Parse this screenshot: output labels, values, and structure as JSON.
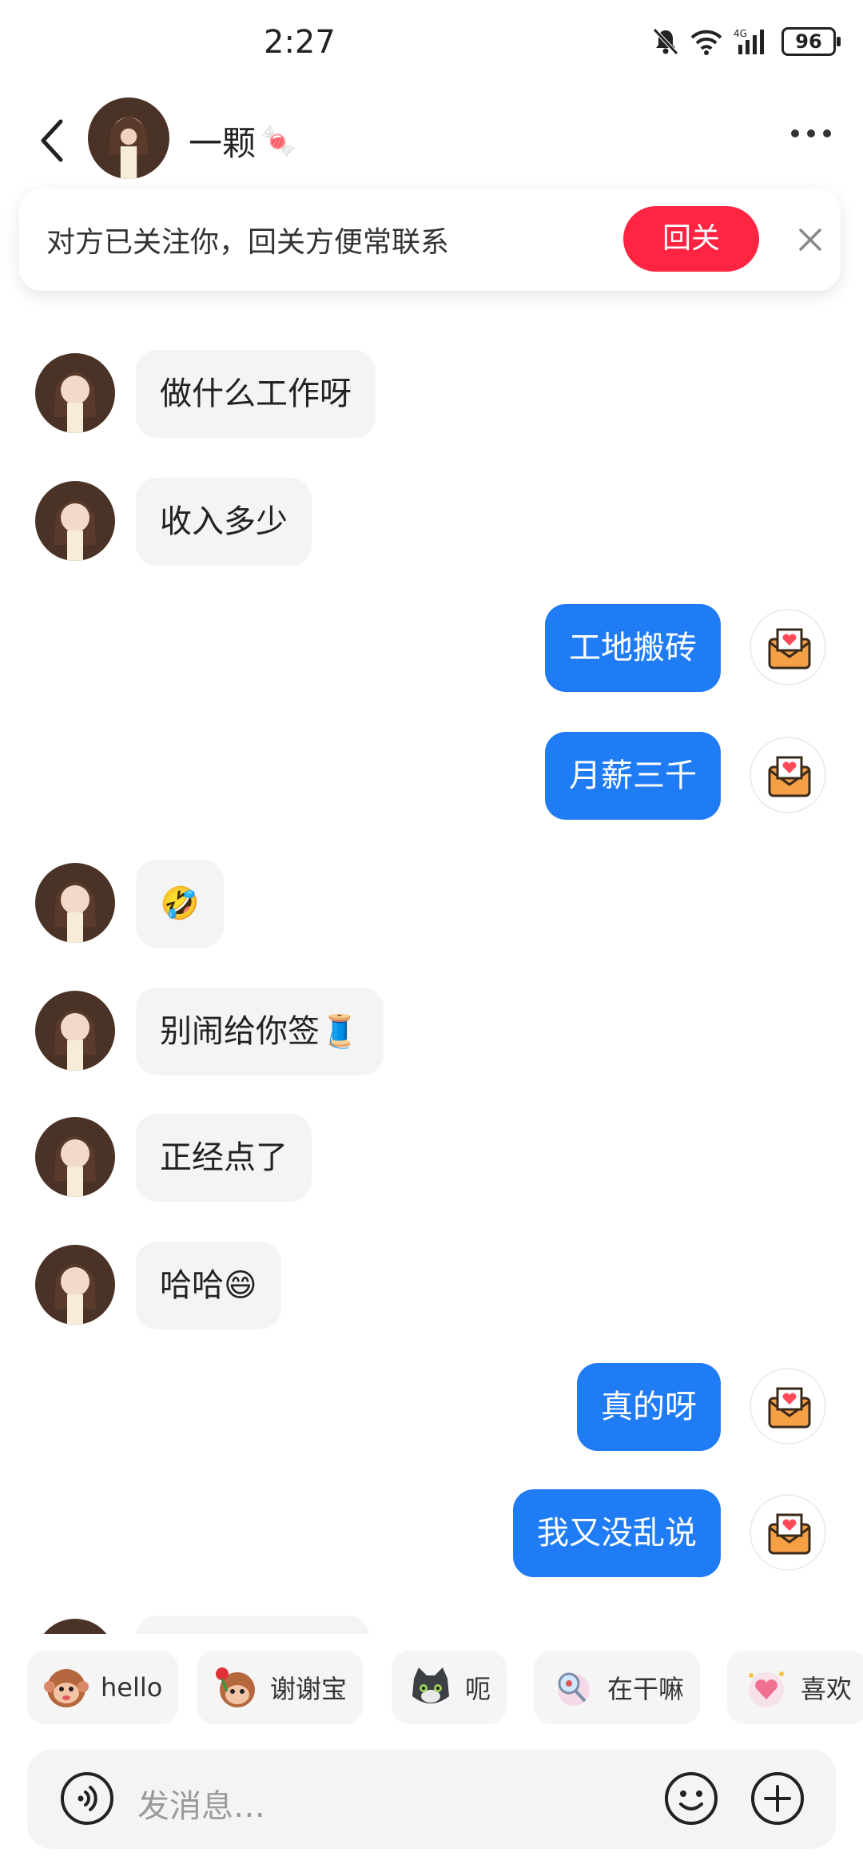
{
  "status_bar": {
    "time": "2:27",
    "battery": "96",
    "network": "4G"
  },
  "header": {
    "title": "一颗",
    "title_emoji": "🍬"
  },
  "banner": {
    "text": "对方已关注你，回关方便常联系",
    "follow_back_label": "回关"
  },
  "messages": [
    {
      "side": "in",
      "text": "做什么工作呀"
    },
    {
      "side": "in",
      "text": "收入多少"
    },
    {
      "side": "out",
      "text": "工地搬砖"
    },
    {
      "side": "out",
      "text": "月薪三千"
    },
    {
      "side": "in",
      "text": "🤣"
    },
    {
      "side": "in",
      "text": "别闹给你签🧵"
    },
    {
      "side": "in",
      "text": "正经点了"
    },
    {
      "side": "in",
      "text": "哈哈😄"
    },
    {
      "side": "out",
      "text": "真的呀"
    },
    {
      "side": "out",
      "text": "我又没乱说"
    }
  ],
  "quick_replies": [
    {
      "label": "hello",
      "icon": "monkey-icon"
    },
    {
      "label": "谢谢宝",
      "icon": "monkey-rose-icon"
    },
    {
      "label": "呃",
      "icon": "cat-icon"
    },
    {
      "label": "在干嘛",
      "icon": "magnifier-character-icon"
    },
    {
      "label": "喜欢",
      "icon": "heart-character-icon"
    }
  ],
  "input": {
    "placeholder": "发消息…"
  },
  "colors": {
    "accent_blue": "#1f7cf5",
    "follow_red": "#ff2442",
    "bubble_gray": "#f4f4f4"
  }
}
